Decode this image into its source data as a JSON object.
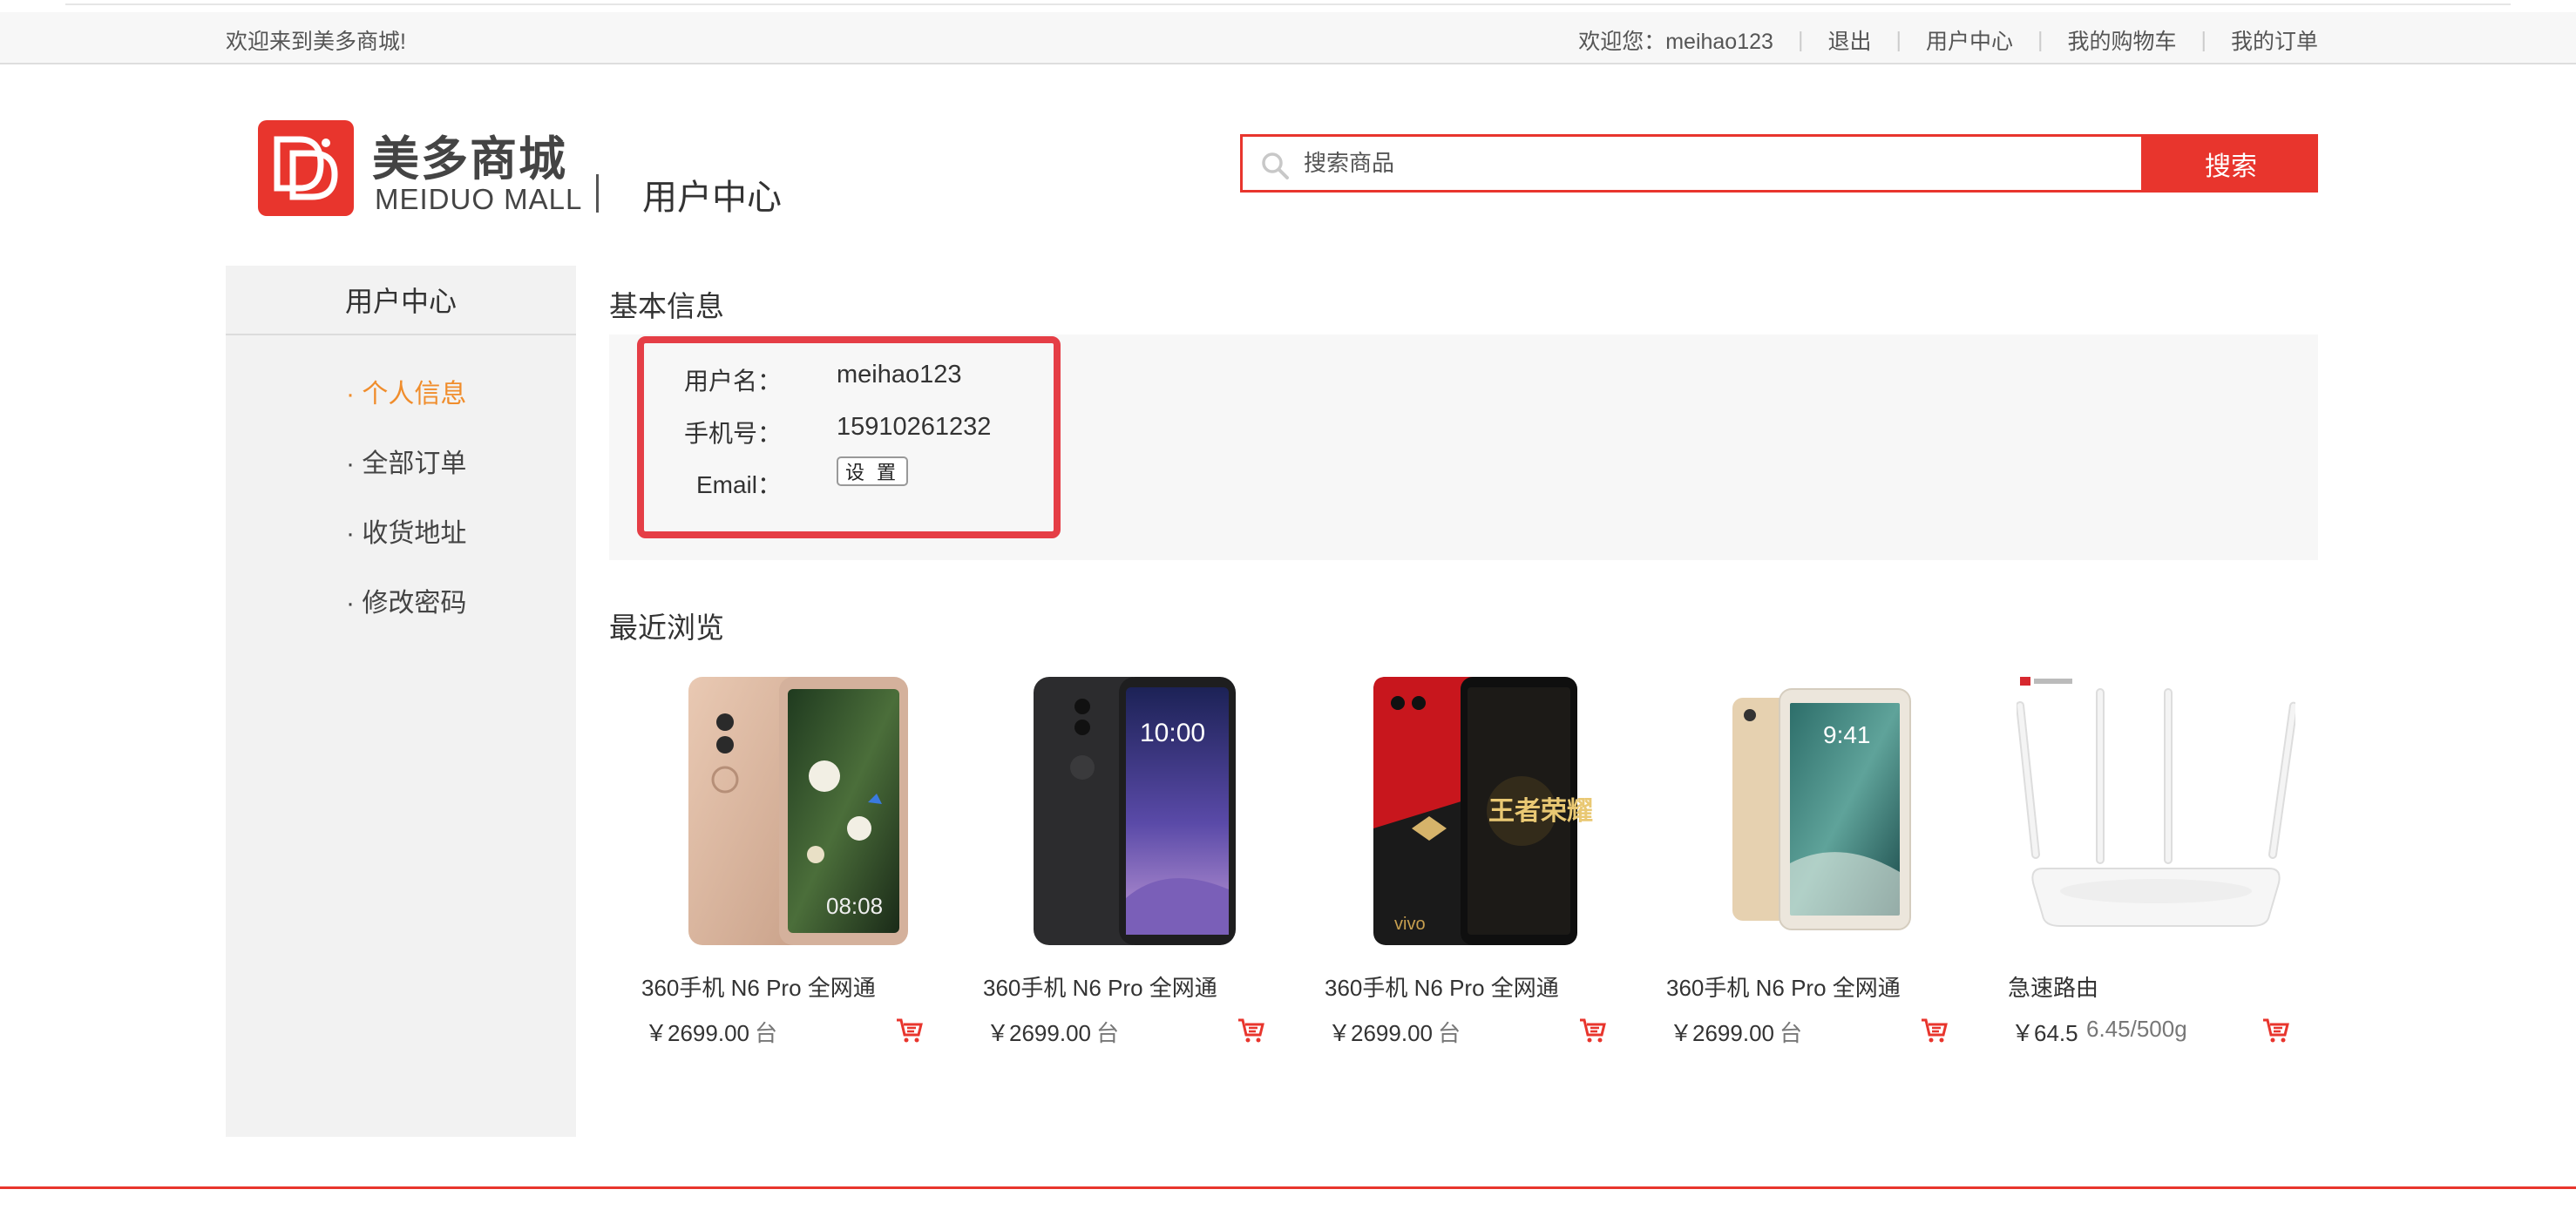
{
  "header": {
    "welcome_left": "欢迎来到美多商城!",
    "welcome_user": "欢迎您：meihao123",
    "logout": "退出",
    "user_center": "用户中心",
    "cart": "我的购物车",
    "orders": "我的订单"
  },
  "brand": {
    "name_cn": "美多商城",
    "name_en": "MEIDUO MALL",
    "section": "用户中心",
    "color": "#e8352d"
  },
  "search": {
    "placeholder": "搜索商品",
    "button": "搜索"
  },
  "sidebar": {
    "title": "用户中心",
    "items": [
      {
        "label": "· 个人信息",
        "active": true
      },
      {
        "label": "· 全部订单",
        "active": false
      },
      {
        "label": "· 收货地址",
        "active": false
      },
      {
        "label": "· 修改密码",
        "active": false
      }
    ],
    "active_color": "#f08d2c"
  },
  "basic_info": {
    "heading": "基本信息",
    "username_label": "用户名：",
    "username": "meihao123",
    "phone_label": "手机号：",
    "phone": "15910261232",
    "email_label": "Email：",
    "email_button": "设 置"
  },
  "recent": {
    "heading": "最近浏览",
    "products": [
      {
        "name": "360手机 N6 Pro 全网通",
        "price": "￥2699.00",
        "unit": "台",
        "image": "phone-gold"
      },
      {
        "name": "360手机 N6 Pro 全网通",
        "price": "￥2699.00",
        "unit": "台",
        "image": "phone-black"
      },
      {
        "name": "360手机 N6 Pro 全网通",
        "price": "￥2699.00",
        "unit": "台",
        "image": "phone-red"
      },
      {
        "name": "360手机 N6 Pro 全网通",
        "price": "￥2699.00",
        "unit": "台",
        "image": "tablet-gold"
      },
      {
        "name": "急速路由",
        "price": "￥64.5",
        "unit": "6.45/500g",
        "image": "router-white"
      }
    ]
  }
}
